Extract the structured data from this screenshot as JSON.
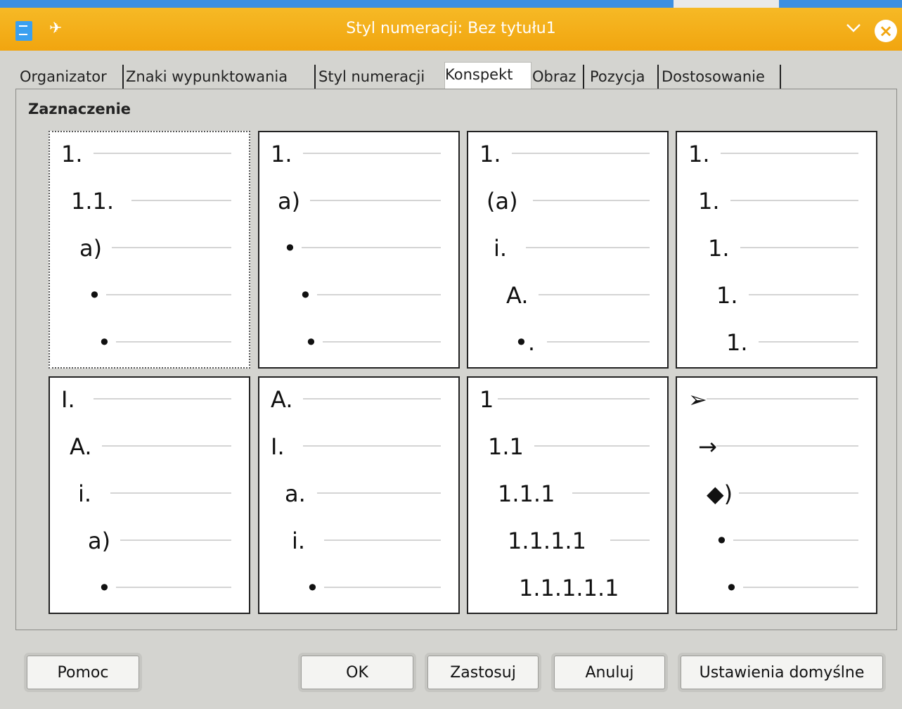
{
  "window": {
    "title": "Styl numeracji: Bez tytułu1"
  },
  "tabs": [
    {
      "label": "Organizator",
      "active": false
    },
    {
      "label": "Znaki wypunktowania",
      "active": false
    },
    {
      "label": "Styl numeracji",
      "active": false
    },
    {
      "label": "Konspekt",
      "active": true
    },
    {
      "label": "Obraz",
      "active": false
    },
    {
      "label": "Pozycja",
      "active": false
    },
    {
      "label": "Dostosowanie",
      "active": false
    }
  ],
  "section_title": "Zaznaczenie",
  "presets": [
    {
      "selected": true,
      "levels": [
        "1.",
        "1.1.",
        "a)",
        "•",
        "•"
      ]
    },
    {
      "selected": false,
      "levels": [
        "1.",
        "a)",
        "•",
        "•",
        "•"
      ]
    },
    {
      "selected": false,
      "levels": [
        "1.",
        "(a)",
        "i.",
        "A.",
        "•."
      ]
    },
    {
      "selected": false,
      "levels": [
        "1.",
        "1.",
        "1.",
        "1.",
        "1."
      ]
    },
    {
      "selected": false,
      "levels": [
        "I.",
        "A.",
        "i.",
        "a)",
        "•"
      ]
    },
    {
      "selected": false,
      "levels": [
        "A.",
        "I.",
        "a.",
        "i.",
        "•"
      ]
    },
    {
      "selected": false,
      "levels": [
        "1",
        "1.1",
        "1.1.1",
        "1.1.1.1",
        "1.1.1.1.1"
      ]
    },
    {
      "selected": false,
      "levels": [
        "➢",
        "→",
        "◆)",
        "•",
        "•"
      ]
    }
  ],
  "buttons": {
    "help": "Pomoc",
    "ok": "OK",
    "apply": "Zastosuj",
    "cancel": "Anuluj",
    "reset": "Ustawienia domyślne"
  },
  "colors": {
    "titlebar": "#f1a50f",
    "dialog_bg": "#d4d4d0"
  }
}
